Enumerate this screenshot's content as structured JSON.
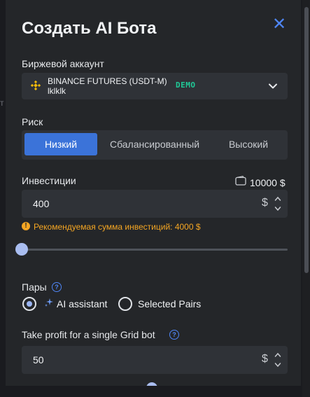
{
  "modal": {
    "title": "Создать AI Бота"
  },
  "account": {
    "label": "Биржевой аккаунт",
    "exchange": "BINANCE FUTURES (USDT-M)",
    "account_name": "lklklk",
    "badge": "DEMO",
    "badge_color": "#20c997"
  },
  "risk": {
    "label": "Риск",
    "options": [
      "Низкий",
      "Сбалансированный",
      "Высокий"
    ],
    "selected": "Низкий",
    "accent_color": "#3b73d9"
  },
  "investment": {
    "label": "Инвестиции",
    "balance": "10000 $",
    "value": "400",
    "currency": "$",
    "warning": "Рекомендуемая сумма инвестиций: 4000 $",
    "warning_color": "#f5a623",
    "slider_fraction": 0.0
  },
  "pairs": {
    "label": "Пары",
    "options": [
      "AI assistant",
      "Selected Pairs"
    ],
    "selected": "AI assistant"
  },
  "take_profit": {
    "label": "Take profit for a single Grid bot",
    "value": "50",
    "currency": "$"
  },
  "icons": {
    "close": "close-icon",
    "exchange_logo": "binance-logo-icon",
    "dropdown": "chevron-down-icon",
    "wallet": "wallet-icon",
    "warning": "warning-circle-icon",
    "help": "help-circle-icon",
    "sparkle": "sparkle-icon"
  }
}
